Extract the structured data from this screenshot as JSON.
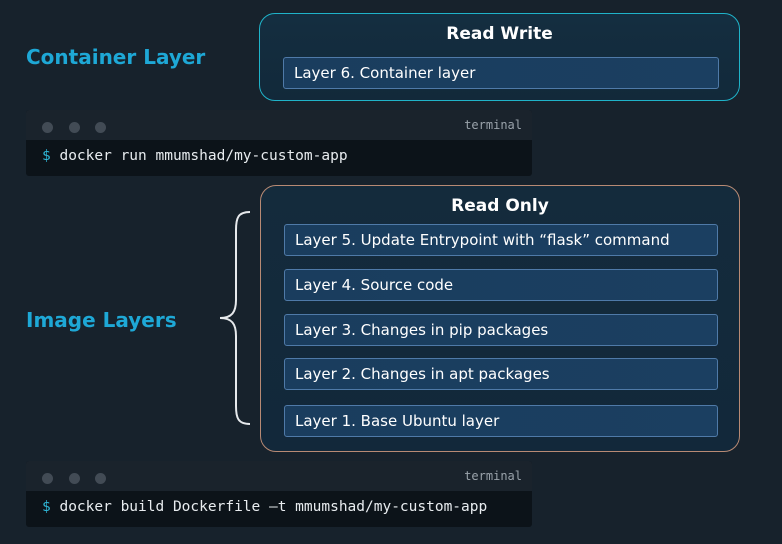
{
  "labels": {
    "container_layer": "Container Layer",
    "image_layers": "Image Layers"
  },
  "read_write": {
    "title": "Read Write",
    "layers": [
      "Layer 6. Container layer"
    ]
  },
  "read_only": {
    "title": "Read Only",
    "layers": [
      "Layer 5. Update Entrypoint with “flask” command",
      "Layer 4. Source code",
      "Layer 3. Changes in pip packages",
      "Layer 2. Changes in apt packages",
      "Layer 1. Base Ubuntu layer"
    ]
  },
  "terminals": [
    {
      "title": "terminal",
      "prompt": "$",
      "command": "docker run mmumshad/my-custom-app"
    },
    {
      "title": "terminal",
      "prompt": "$",
      "command": "docker build Dockerfile –t mmumshad/my-custom-app"
    }
  ],
  "colors": {
    "background": "#17222c",
    "accent_label": "#1ea8d6",
    "read_write_border": "#1fb3c9",
    "read_only_border": "#b88a74",
    "layer_fill": "#1a3d5e"
  }
}
